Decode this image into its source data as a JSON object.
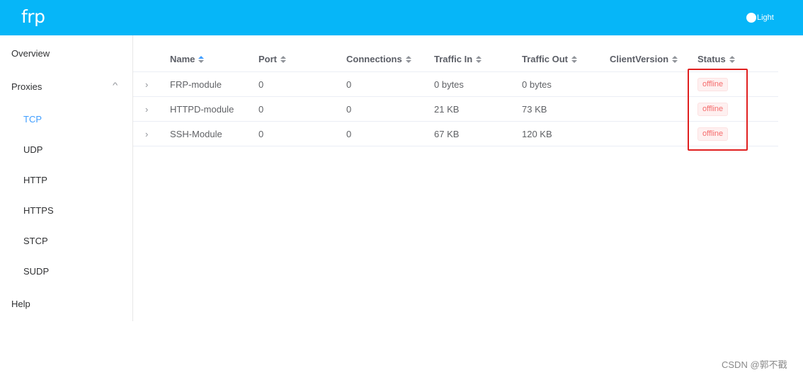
{
  "header": {
    "logo": "frp",
    "theme_toggle_label": "Light"
  },
  "sidebar": {
    "items": [
      {
        "label": "Overview"
      },
      {
        "label": "Proxies"
      },
      {
        "label": "TCP"
      },
      {
        "label": "UDP"
      },
      {
        "label": "HTTP"
      },
      {
        "label": "HTTPS"
      },
      {
        "label": "STCP"
      },
      {
        "label": "SUDP"
      },
      {
        "label": "Help"
      }
    ]
  },
  "table": {
    "columns": [
      "Name",
      "Port",
      "Connections",
      "Traffic In",
      "Traffic Out",
      "ClientVersion",
      "Status"
    ],
    "rows": [
      {
        "name": "FRP-module",
        "port": "0",
        "connections": "0",
        "traffic_in": "0 bytes",
        "traffic_out": "0 bytes",
        "client_version": "",
        "status": "offline"
      },
      {
        "name": "HTTPD-module",
        "port": "0",
        "connections": "0",
        "traffic_in": "21 KB",
        "traffic_out": "73 KB",
        "client_version": "",
        "status": "offline"
      },
      {
        "name": "SSH-Module",
        "port": "0",
        "connections": "0",
        "traffic_in": "67 KB",
        "traffic_out": "120 KB",
        "client_version": "",
        "status": "offline"
      }
    ]
  },
  "watermark": "CSDN @郭不戳",
  "colors": {
    "header_bg": "#06b6f8",
    "active_menu": "#409eff",
    "offline_badge": "#f56c6c",
    "highlight_box": "#e02020"
  }
}
